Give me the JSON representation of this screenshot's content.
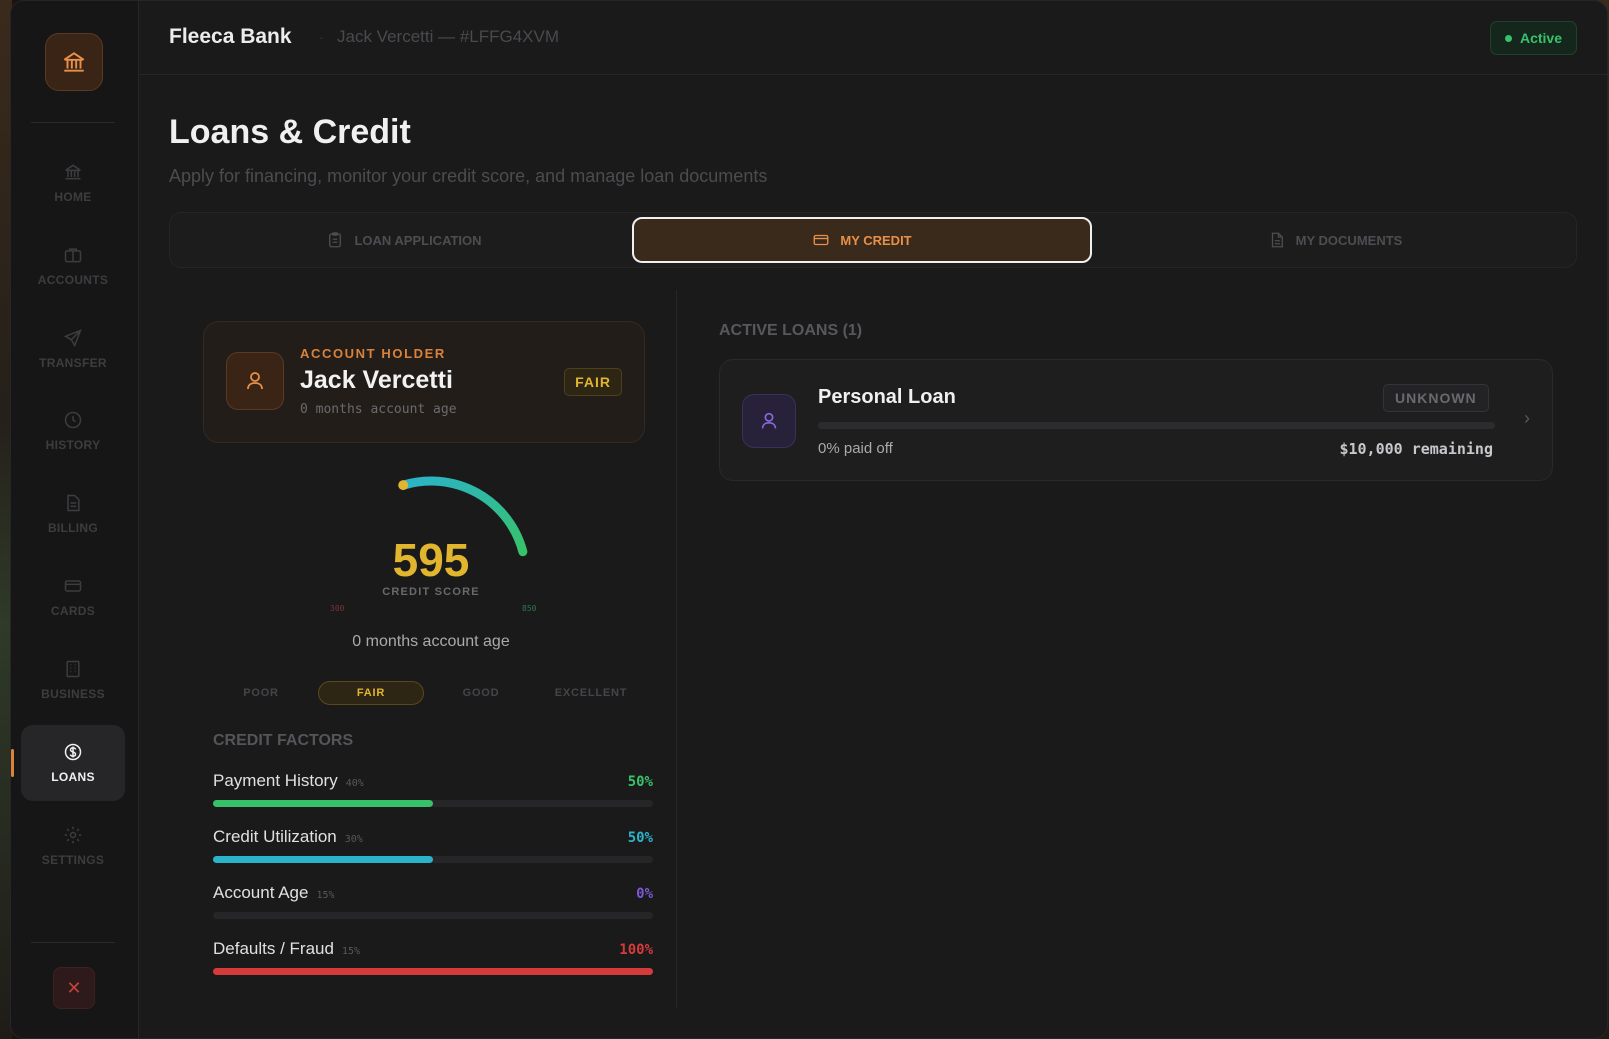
{
  "app": {
    "brand": "Fleeca Bank",
    "separator": "·",
    "account_line": "Jack Vercetti — #LFFG4XVM",
    "status": "Active"
  },
  "sidebar": {
    "items": [
      {
        "label": "HOME",
        "icon": "bank-icon"
      },
      {
        "label": "ACCOUNTS",
        "icon": "briefcase-icon"
      },
      {
        "label": "TRANSFER",
        "icon": "send-icon"
      },
      {
        "label": "HISTORY",
        "icon": "clock-icon"
      },
      {
        "label": "BILLING",
        "icon": "document-icon"
      },
      {
        "label": "CARDS",
        "icon": "card-icon"
      },
      {
        "label": "BUSINESS",
        "icon": "building-icon"
      },
      {
        "label": "LOANS",
        "icon": "dollar-circle-icon",
        "active": true
      },
      {
        "label": "SETTINGS",
        "icon": "gear-icon"
      }
    ],
    "close": "✕"
  },
  "page": {
    "title": "Loans & Credit",
    "subtitle": "Apply for financing, monitor your credit score, and manage loan documents"
  },
  "tabs": [
    {
      "label": "LOAN APPLICATION",
      "icon": "clipboard-icon"
    },
    {
      "label": "MY CREDIT",
      "icon": "card-icon",
      "active": true
    },
    {
      "label": "MY DOCUMENTS",
      "icon": "file-icon"
    }
  ],
  "holder": {
    "label": "ACCOUNT HOLDER",
    "name": "Jack Vercetti",
    "age": "0 months account age",
    "rating": "FAIR"
  },
  "credit": {
    "score": "595",
    "score_value": 595,
    "label": "CREDIT SCORE",
    "min": "300",
    "max": "850",
    "min_value": 300,
    "max_value": 850,
    "age_caption": "0 months account age",
    "bands": [
      "POOR",
      "FAIR",
      "GOOD",
      "EXCELLENT"
    ],
    "active_band": "FAIR",
    "gauge_colors": [
      "#e2b52e",
      "#2bb3c9",
      "#37c26a"
    ]
  },
  "factors": {
    "title": "CREDIT FACTORS",
    "items": [
      {
        "name": "Payment History",
        "weight": "40%",
        "pct": "50%",
        "value": 0.5,
        "color": "#37c26a"
      },
      {
        "name": "Credit Utilization",
        "weight": "30%",
        "pct": "50%",
        "value": 0.5,
        "color": "#2bb3c9"
      },
      {
        "name": "Account Age",
        "weight": "15%",
        "pct": "0%",
        "value": 0,
        "color": "#7b57d6"
      },
      {
        "name": "Defaults / Fraud",
        "weight": "15%",
        "pct": "100%",
        "value": 1,
        "color": "#d63b3b"
      }
    ]
  },
  "loans": {
    "title": "ACTIVE LOANS (1)",
    "items": [
      {
        "name": "Personal Loan",
        "status": "UNKNOWN",
        "paid": "0% paid off",
        "paid_value": 0,
        "remaining": "$10,000 remaining"
      }
    ]
  }
}
